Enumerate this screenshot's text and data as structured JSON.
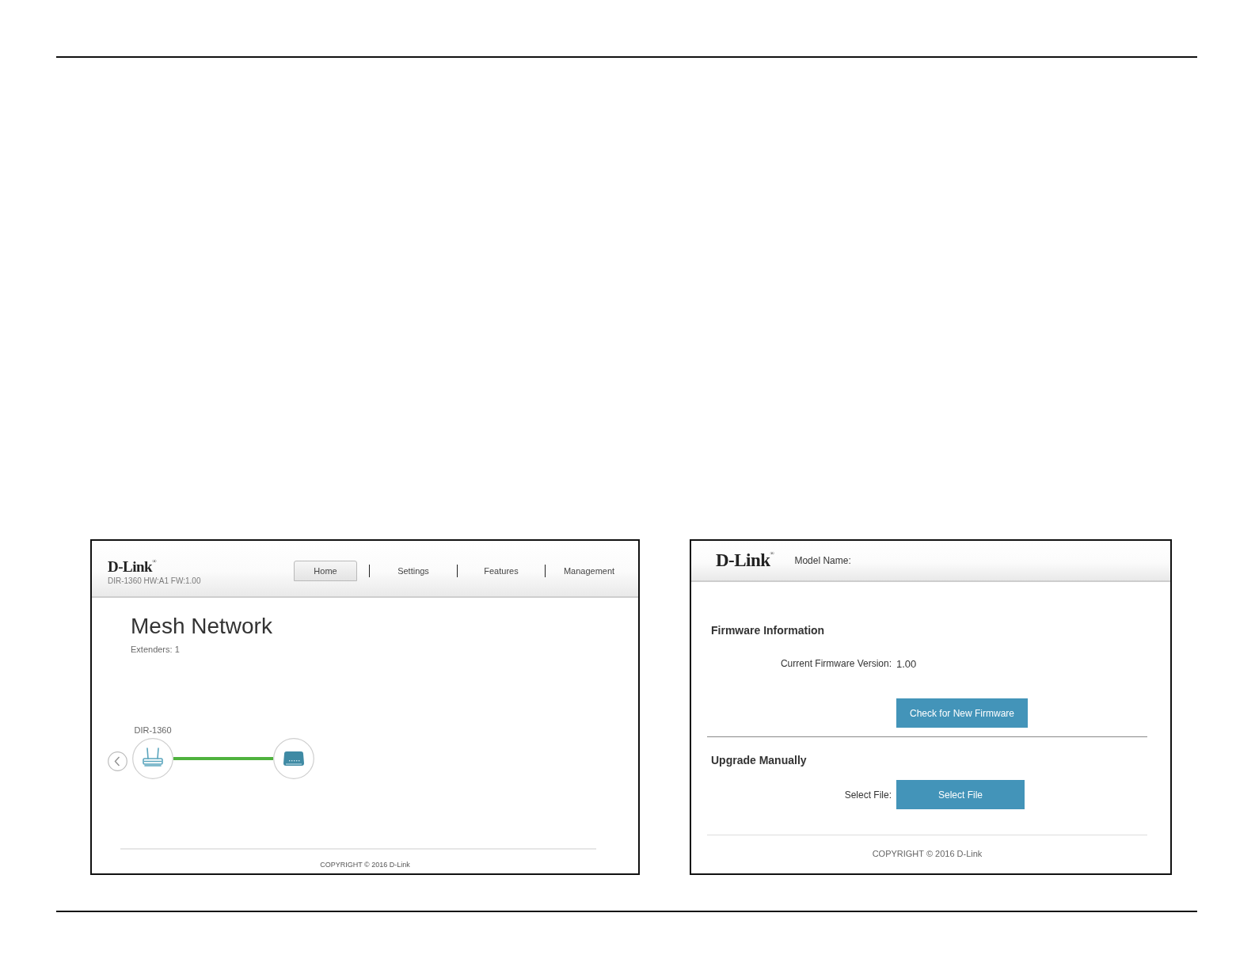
{
  "home_screen": {
    "logo": "D-Link$^{®}$",
    "device_info": "DIR-1360 HW:A1 FW:1.00",
    "tabs": [
      {
        "label": "Home",
        "selected": true
      },
      {
        "label": "Settings",
        "selected": false
      },
      {
        "label": "Features",
        "selected": false
      },
      {
        "label": "Management",
        "selected": false
      }
    ],
    "title": "Mesh Network",
    "extenders": "Extenders: 1",
    "nodes": [
      {
        "kind": "router",
        "label": "DIR-1360"
      },
      {
        "kind": "extender"
      }
    ],
    "copyright": "COPYRIGHT © 2016 D-Link"
  },
  "firmware_screen": {
    "logo": "D-Link$^{®}$",
    "model_label": "Model Name:",
    "sections": [
      {
        "heading": "Firmware Information",
        "rows": [
          {
            "kind": "value",
            "label": "Current Firmware Version:",
            "value": "1.00"
          },
          {
            "kind": "button",
            "button": "Check for New Firmware"
          }
        ]
      },
      {
        "heading": "Upgrade Manually",
        "rows": [
          {
            "kind": "button",
            "label": "Select File:",
            "button": "Select File"
          }
        ]
      }
    ],
    "copyright": "COPYRIGHT © 2016 D-Link"
  }
}
